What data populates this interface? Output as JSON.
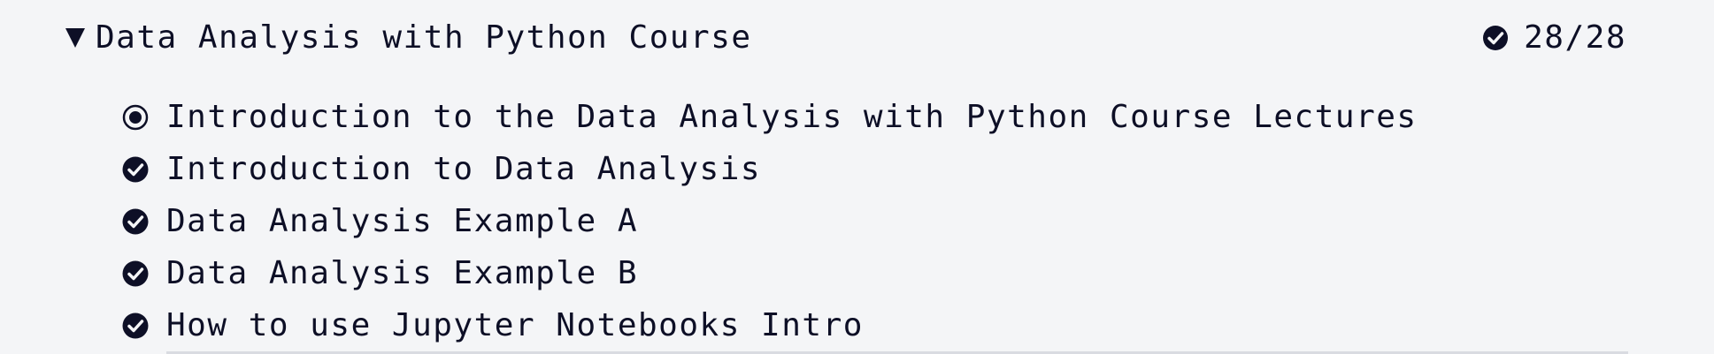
{
  "course": {
    "title": "Data Analysis with Python Course",
    "toggle_icon": "triangle-down-icon",
    "progress_icon": "check-circle-icon",
    "progress_text": "28/28"
  },
  "lessons": [
    {
      "title": "Introduction to the Data Analysis with Python Course Lectures",
      "icon": "current-radio-icon",
      "status": "current"
    },
    {
      "title": "Introduction to Data Analysis",
      "icon": "check-circle-icon",
      "status": "completed"
    },
    {
      "title": "Data Analysis Example A",
      "icon": "check-circle-icon",
      "status": "completed"
    },
    {
      "title": "Data Analysis Example B",
      "icon": "check-circle-icon",
      "status": "completed"
    },
    {
      "title": "How to use Jupyter Notebooks Intro",
      "icon": "check-circle-icon",
      "status": "completed"
    }
  ],
  "colors": {
    "background": "#f4f5f7",
    "text": "#0d0f26",
    "divider": "#d9dbe1"
  }
}
